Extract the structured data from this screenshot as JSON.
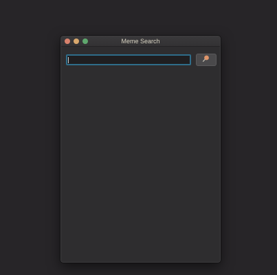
{
  "window": {
    "title": "Meme Search"
  },
  "search": {
    "value": "",
    "placeholder": ""
  },
  "colors": {
    "close": "#d9826d",
    "minimize": "#d9a86d",
    "zoom": "#5fa86e",
    "focus_ring": "#2f6d8a",
    "search_icon": "#e0956a"
  },
  "icons": {
    "search_button": "magnifier-icon"
  }
}
